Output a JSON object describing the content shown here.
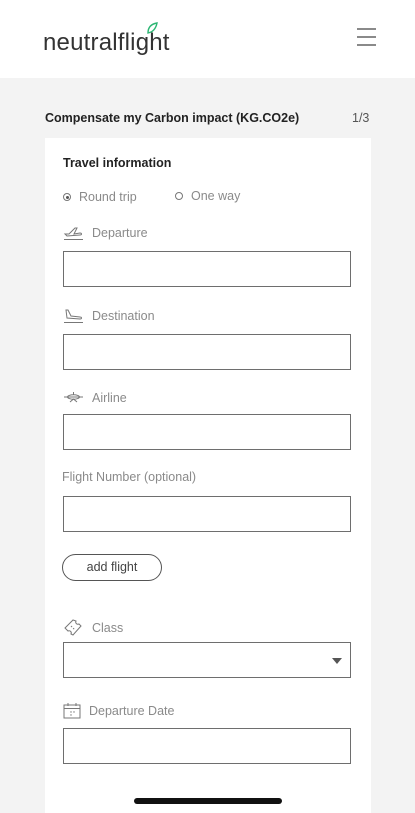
{
  "header": {
    "logo_text": "neutralflight"
  },
  "form": {
    "section_title": "Compensate my Carbon impact (KG.CO2e)",
    "step": "1/3",
    "card_title": "Travel information",
    "trip_type": {
      "round_trip": "Round trip",
      "one_way": "One way",
      "selected": "Round trip"
    },
    "departure_label": "Departure",
    "departure_value": "",
    "destination_label": "Destination",
    "destination_value": "",
    "airline_label": "Airline",
    "airline_value": "",
    "flight_number_label": "Flight Number (optional)",
    "flight_number_value": "",
    "add_flight_label": "add flight",
    "class_label": "Class",
    "class_value": "",
    "departure_date_label": "Departure Date",
    "departure_date_value": ""
  },
  "colors": {
    "accent": "#2bb673",
    "background": "#f3f3f3",
    "card": "#ffffff",
    "border": "#6e6e6e"
  }
}
